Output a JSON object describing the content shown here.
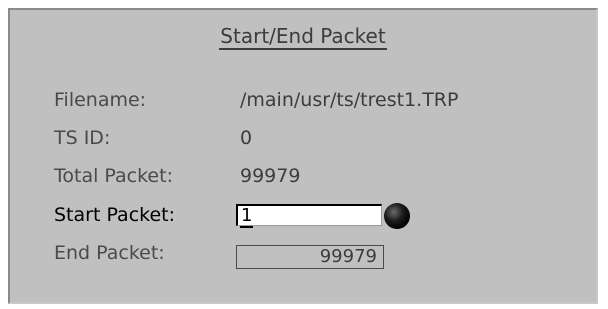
{
  "title": "Start/End Packet",
  "fields": {
    "filename": {
      "label": "Filename:",
      "value": "/main/usr/ts/trest1.TRP"
    },
    "ts_id": {
      "label": "TS ID:",
      "value": "0"
    },
    "total_packet": {
      "label": "Total Packet:",
      "value": "99979"
    },
    "start_packet": {
      "label": "Start Packet:",
      "value": "1"
    },
    "end_packet": {
      "label": "End Packet:",
      "value": "99979"
    }
  },
  "icons": {
    "spinner": "knob-icon"
  },
  "colors": {
    "panel_bg": "#c0c0c0",
    "text": "#3c3c3c",
    "active_text": "#000000",
    "input_bg": "#ffffff"
  }
}
